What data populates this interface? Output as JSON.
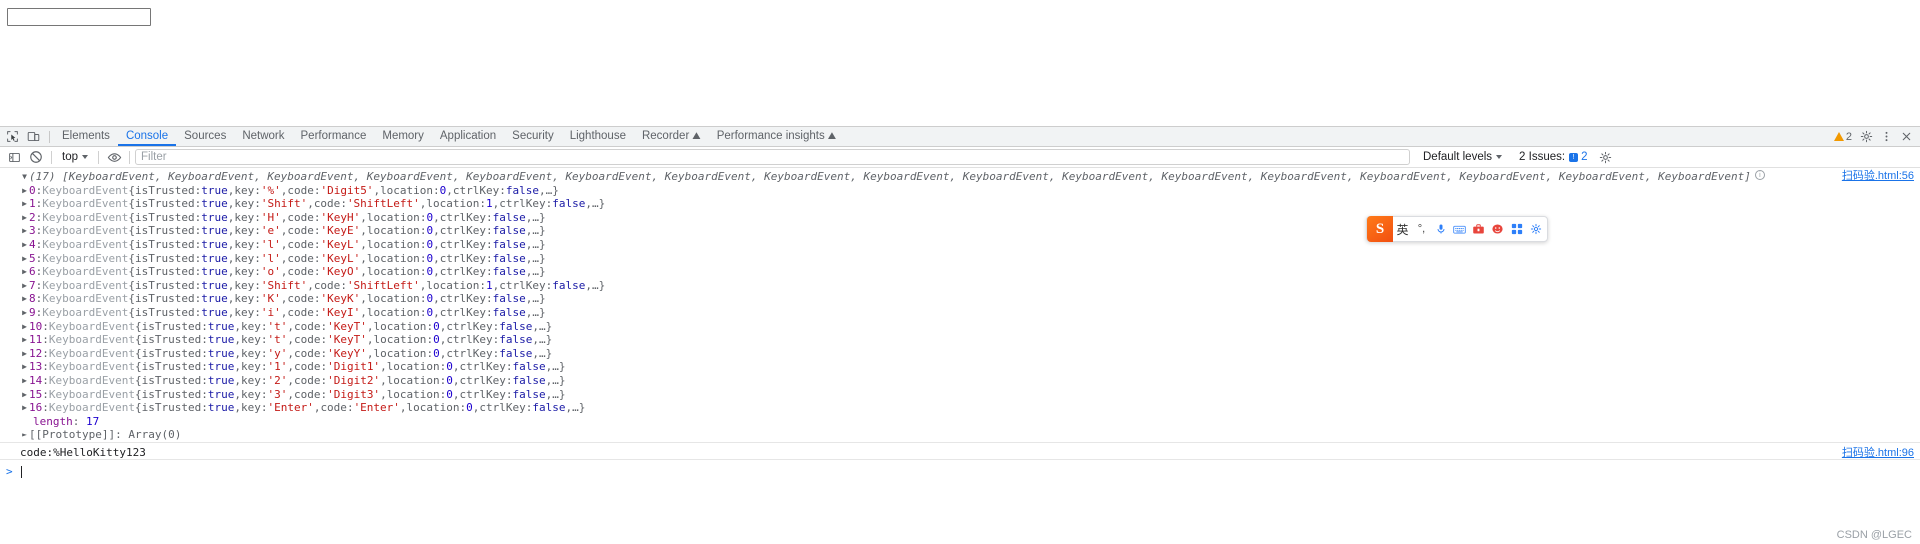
{
  "page": {
    "input_value": "",
    "input_placeholder": ""
  },
  "devtools": {
    "tabs": [
      {
        "label": "Elements",
        "active": false,
        "experimental": false
      },
      {
        "label": "Console",
        "active": true,
        "experimental": false
      },
      {
        "label": "Sources",
        "active": false,
        "experimental": false
      },
      {
        "label": "Network",
        "active": false,
        "experimental": false
      },
      {
        "label": "Performance",
        "active": false,
        "experimental": false
      },
      {
        "label": "Memory",
        "active": false,
        "experimental": false
      },
      {
        "label": "Application",
        "active": false,
        "experimental": false
      },
      {
        "label": "Security",
        "active": false,
        "experimental": false
      },
      {
        "label": "Lighthouse",
        "active": false,
        "experimental": false
      },
      {
        "label": "Recorder",
        "active": false,
        "experimental": true
      },
      {
        "label": "Performance insights",
        "active": false,
        "experimental": true
      }
    ],
    "warning_count": "2",
    "accent_color": "#1a73e8",
    "toolbar": {
      "inspect_icon": "inspect-element-icon",
      "device_icon": "device-toolbar-icon",
      "settings_icon": "gear-icon",
      "more_icon": "more-vertical-icon",
      "close_icon": "close-icon"
    }
  },
  "console_toolbar": {
    "sidebar_icon": "console-sidebar-icon",
    "clear_icon": "clear-console-icon",
    "context": "top",
    "eye_icon": "live-expression-eye-icon",
    "filter_value": "",
    "filter_placeholder": "Filter",
    "levels_label": "Default levels",
    "issues_label": "2 Issues:",
    "issues_count": "2",
    "settings_icon": "gear-icon"
  },
  "console": {
    "summary": {
      "count": "(17)",
      "text": "[KeyboardEvent, KeyboardEvent, KeyboardEvent, KeyboardEvent, KeyboardEvent, KeyboardEvent, KeyboardEvent, KeyboardEvent, KeyboardEvent, KeyboardEvent, KeyboardEvent, KeyboardEvent, KeyboardEvent, KeyboardEvent, KeyboardEvent, KeyboardEvent, KeyboardEvent]",
      "source_link": "扫码验.html:56",
      "info_badge": "i"
    },
    "class_name": "KeyboardEvent",
    "prop_istrusted": "isTrusted",
    "prop_key": "key",
    "prop_code": "code",
    "prop_location": "location",
    "prop_ctrlkey": "ctrlKey",
    "value_true": "true",
    "value_false": "false",
    "ellipsis": "…",
    "entries": [
      {
        "index": "0",
        "key": "%",
        "code": "Digit5",
        "location": "0",
        "ctrlKey": "false",
        "tail": "…}"
      },
      {
        "index": "1",
        "key": "Shift",
        "code": "ShiftLeft",
        "location": "1",
        "ctrlKey": "false",
        "tail": "…}"
      },
      {
        "index": "2",
        "key": "H",
        "code": "KeyH",
        "location": "0",
        "ctrlKey": "false",
        "tail": "…}"
      },
      {
        "index": "3",
        "key": "e",
        "code": "KeyE",
        "location": "0",
        "ctrlKey": "false",
        "tail": "…}"
      },
      {
        "index": "4",
        "key": "l",
        "code": "KeyL",
        "location": "0",
        "ctrlKey": "false",
        "tail": "…}"
      },
      {
        "index": "5",
        "key": "l",
        "code": "KeyL",
        "location": "0",
        "ctrlKey": "false",
        "tail": "…}"
      },
      {
        "index": "6",
        "key": "o",
        "code": "KeyO",
        "location": "0",
        "ctrlKey": "false",
        "tail": "…}"
      },
      {
        "index": "7",
        "key": "Shift",
        "code": "ShiftLeft",
        "location": "1",
        "ctrlKey": "false",
        "tail": "…}"
      },
      {
        "index": "8",
        "key": "K",
        "code": "KeyK",
        "location": "0",
        "ctrlKey": "false",
        "tail": "…}"
      },
      {
        "index": "9",
        "key": "i",
        "code": "KeyI",
        "location": "0",
        "ctrlKey": "false",
        "tail": "…}"
      },
      {
        "index": "10",
        "key": "t",
        "code": "KeyT",
        "location": "0",
        "ctrlKey": "false",
        "tail": "…}"
      },
      {
        "index": "11",
        "key": "t",
        "code": "KeyT",
        "location": "0",
        "ctrlKey": "false",
        "tail": "…}"
      },
      {
        "index": "12",
        "key": "y",
        "code": "KeyY",
        "location": "0",
        "ctrlKey": "false",
        "tail": "…}"
      },
      {
        "index": "13",
        "key": "1",
        "code": "Digit1",
        "location": "0",
        "ctrlKey": "false",
        "tail": "…}"
      },
      {
        "index": "14",
        "key": "2",
        "code": "Digit2",
        "location": "0",
        "ctrlKey": "false",
        "tail": "…}"
      },
      {
        "index": "15",
        "key": "3",
        "code": "Digit3",
        "location": "0",
        "ctrlKey": "false",
        "tail": "…}"
      },
      {
        "index": "16",
        "key": "Enter",
        "code": "Enter",
        "location": "0",
        "ctrlKey": "false",
        "tail": "…}"
      }
    ],
    "length_label": "length",
    "length_value": "17",
    "prototype_label": "[[Prototype]]",
    "prototype_value": "Array(0)",
    "output_line": "code:%HelloKitty123",
    "output_source_link": "扫码验.html:96",
    "prompt_symbol": ">",
    "prompt_value": ""
  },
  "ime": {
    "logo": "S",
    "items": [
      {
        "name": "language-mode",
        "glyph": "英",
        "kind": "text"
      },
      {
        "name": "punctuation-mode",
        "glyph": "°,",
        "kind": "text"
      },
      {
        "name": "voice-input-icon",
        "glyph": "mic",
        "kind": "icon"
      },
      {
        "name": "soft-keyboard-icon",
        "glyph": "keyboard",
        "kind": "icon"
      },
      {
        "name": "toolbox-icon",
        "glyph": "toolbox",
        "kind": "icon"
      },
      {
        "name": "emoji-icon",
        "glyph": "emoji",
        "kind": "icon"
      },
      {
        "name": "apps-icon",
        "glyph": "apps",
        "kind": "icon"
      },
      {
        "name": "settings-icon",
        "glyph": "gear",
        "kind": "icon"
      }
    ]
  },
  "watermark": "CSDN @LGEC"
}
